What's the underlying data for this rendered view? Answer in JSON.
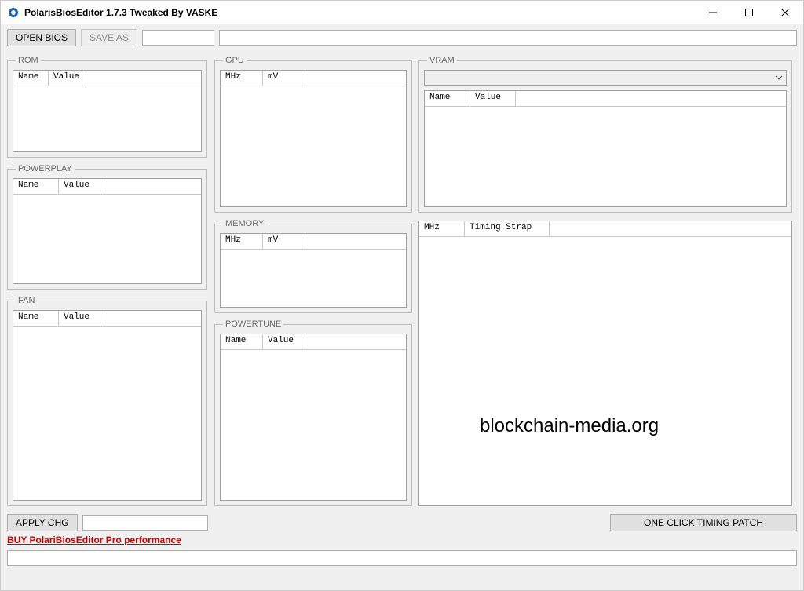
{
  "window": {
    "title": "PolarisBiosEditor 1.7.3 Tweaked By VASKE"
  },
  "toolbar": {
    "open_bios": "OPEN BIOS",
    "save_as": "SAVE AS"
  },
  "groups": {
    "rom": {
      "legend": "ROM",
      "cols": {
        "name": "Name",
        "value": "Value"
      }
    },
    "powerplay": {
      "legend": "POWERPLAY",
      "cols": {
        "name": "Name",
        "value": "Value"
      }
    },
    "fan": {
      "legend": "FAN",
      "cols": {
        "name": "Name",
        "value": "Value"
      }
    },
    "gpu": {
      "legend": "GPU",
      "cols": {
        "mhz": "MHz",
        "mv": "mV"
      }
    },
    "memory": {
      "legend": "MEMORY",
      "cols": {
        "mhz": "MHz",
        "mv": "mV"
      }
    },
    "powertune": {
      "legend": "POWERTUNE",
      "cols": {
        "name": "Name",
        "value": "Value"
      }
    },
    "vram": {
      "legend": "VRAM",
      "cols": {
        "name": "Name",
        "value": "Value"
      }
    },
    "strap": {
      "cols": {
        "mhz": "MHz",
        "strap": "Timing Strap"
      }
    }
  },
  "bottom": {
    "apply_chg": "APPLY CHG",
    "patch": "ONE CLICK TIMING PATCH",
    "buy_link": "BUY PolariBiosEditor Pro performance"
  },
  "watermark": "blockchain-media.org"
}
